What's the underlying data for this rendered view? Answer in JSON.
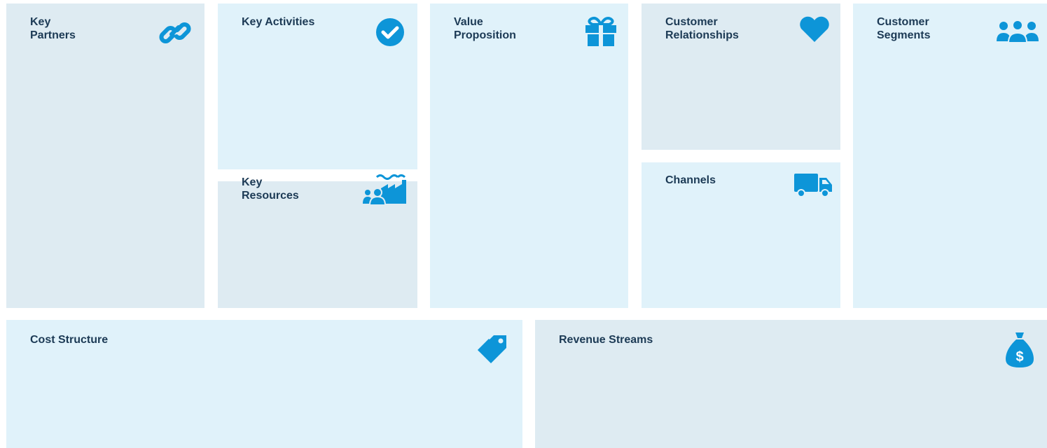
{
  "canvas": {
    "colors": {
      "light_fill": "#e0f2fa",
      "grey_fill": "#deebf2",
      "icon": "#0d95d8",
      "title_text": "#1c3a55"
    },
    "blocks": {
      "key_partners": {
        "title": "Key\nPartners",
        "icon": "link-icon"
      },
      "key_activities": {
        "title": "Key Activities",
        "icon": "check-circle-icon"
      },
      "key_resources": {
        "title": "Key\nResources",
        "icon": "factory-people-icon"
      },
      "value_proposition": {
        "title": "Value\nProposition",
        "icon": "gift-icon"
      },
      "customer_relationships": {
        "title": "Customer\nRelationships",
        "icon": "heart-icon"
      },
      "channels": {
        "title": "Channels",
        "icon": "truck-icon"
      },
      "customer_segments": {
        "title": "Customer\nSegments",
        "icon": "users-group-icon"
      },
      "cost_structure": {
        "title": "Cost Structure",
        "icon": "price-tag-icon"
      },
      "revenue_streams": {
        "title": "Revenue Streams",
        "icon": "money-bag-icon"
      }
    }
  }
}
